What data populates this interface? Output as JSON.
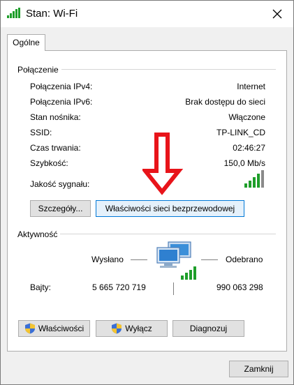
{
  "window": {
    "title": "Stan: Wi-Fi",
    "close_glyph": "✕"
  },
  "tabs": [
    {
      "label": "Ogólne"
    }
  ],
  "connection": {
    "heading": "Połączenie",
    "rows": [
      {
        "label": "Połączenia IPv4:",
        "value": "Internet"
      },
      {
        "label": "Połączenia IPv6:",
        "value": "Brak dostępu do sieci"
      },
      {
        "label": "Stan nośnika:",
        "value": "Włączone"
      },
      {
        "label": "SSID:",
        "value": "TP-LINK_CD"
      },
      {
        "label": "Czas trwania:",
        "value": "02:46:27"
      },
      {
        "label": "Szybkość:",
        "value": "150,0 Mb/s"
      }
    ],
    "signal_label": "Jakość sygnału:",
    "signal_bars": 5,
    "signal_bars_lit": 4,
    "details_button": "Szczegóły...",
    "wireless_props_button": "Właściwości sieci bezprzewodowej"
  },
  "activity": {
    "heading": "Aktywność",
    "sent_label": "Wysłano",
    "received_label": "Odebrano",
    "bytes_label": "Bajty:",
    "bytes_sent": "5 665 720 719",
    "bytes_received": "990 063 298"
  },
  "actions": {
    "properties_button": "Właściwości",
    "disable_button": "Wyłącz",
    "diagnose_button": "Diagnozuj"
  },
  "footer": {
    "close_button": "Zamknij"
  },
  "colors": {
    "accent": "#0078d7",
    "signal_green": "#1e9e2a",
    "arrow_red": "#e8141a"
  },
  "icons": {
    "title": "wifi-signal-icon",
    "close": "close-icon",
    "signal": "signal-strength-icon",
    "network": "network-computers-icon",
    "shield": "uac-shield-icon",
    "annotation": "red-down-arrow-icon"
  }
}
